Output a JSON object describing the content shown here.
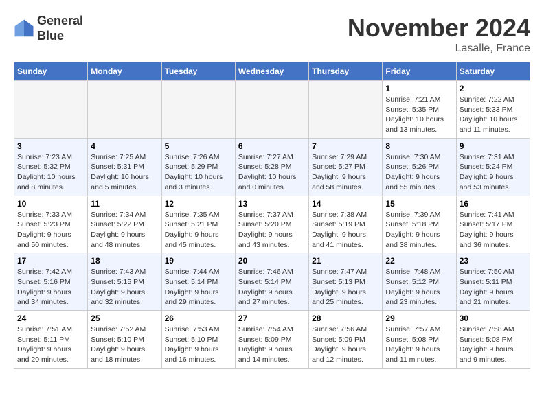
{
  "header": {
    "logo_line1": "General",
    "logo_line2": "Blue",
    "month": "November 2024",
    "location": "Lasalle, France"
  },
  "weekdays": [
    "Sunday",
    "Monday",
    "Tuesday",
    "Wednesday",
    "Thursday",
    "Friday",
    "Saturday"
  ],
  "weeks": [
    [
      {
        "day": "",
        "empty": true
      },
      {
        "day": "",
        "empty": true
      },
      {
        "day": "",
        "empty": true
      },
      {
        "day": "",
        "empty": true
      },
      {
        "day": "",
        "empty": true
      },
      {
        "day": "1",
        "sunrise": "7:21 AM",
        "sunset": "5:35 PM",
        "daylight": "10 hours and 13 minutes."
      },
      {
        "day": "2",
        "sunrise": "7:22 AM",
        "sunset": "5:33 PM",
        "daylight": "10 hours and 11 minutes."
      }
    ],
    [
      {
        "day": "3",
        "sunrise": "7:23 AM",
        "sunset": "5:32 PM",
        "daylight": "10 hours and 8 minutes."
      },
      {
        "day": "4",
        "sunrise": "7:25 AM",
        "sunset": "5:31 PM",
        "daylight": "10 hours and 5 minutes."
      },
      {
        "day": "5",
        "sunrise": "7:26 AM",
        "sunset": "5:29 PM",
        "daylight": "10 hours and 3 minutes."
      },
      {
        "day": "6",
        "sunrise": "7:27 AM",
        "sunset": "5:28 PM",
        "daylight": "10 hours and 0 minutes."
      },
      {
        "day": "7",
        "sunrise": "7:29 AM",
        "sunset": "5:27 PM",
        "daylight": "9 hours and 58 minutes."
      },
      {
        "day": "8",
        "sunrise": "7:30 AM",
        "sunset": "5:26 PM",
        "daylight": "9 hours and 55 minutes."
      },
      {
        "day": "9",
        "sunrise": "7:31 AM",
        "sunset": "5:24 PM",
        "daylight": "9 hours and 53 minutes."
      }
    ],
    [
      {
        "day": "10",
        "sunrise": "7:33 AM",
        "sunset": "5:23 PM",
        "daylight": "9 hours and 50 minutes."
      },
      {
        "day": "11",
        "sunrise": "7:34 AM",
        "sunset": "5:22 PM",
        "daylight": "9 hours and 48 minutes."
      },
      {
        "day": "12",
        "sunrise": "7:35 AM",
        "sunset": "5:21 PM",
        "daylight": "9 hours and 45 minutes."
      },
      {
        "day": "13",
        "sunrise": "7:37 AM",
        "sunset": "5:20 PM",
        "daylight": "9 hours and 43 minutes."
      },
      {
        "day": "14",
        "sunrise": "7:38 AM",
        "sunset": "5:19 PM",
        "daylight": "9 hours and 41 minutes."
      },
      {
        "day": "15",
        "sunrise": "7:39 AM",
        "sunset": "5:18 PM",
        "daylight": "9 hours and 38 minutes."
      },
      {
        "day": "16",
        "sunrise": "7:41 AM",
        "sunset": "5:17 PM",
        "daylight": "9 hours and 36 minutes."
      }
    ],
    [
      {
        "day": "17",
        "sunrise": "7:42 AM",
        "sunset": "5:16 PM",
        "daylight": "9 hours and 34 minutes."
      },
      {
        "day": "18",
        "sunrise": "7:43 AM",
        "sunset": "5:15 PM",
        "daylight": "9 hours and 32 minutes."
      },
      {
        "day": "19",
        "sunrise": "7:44 AM",
        "sunset": "5:14 PM",
        "daylight": "9 hours and 29 minutes."
      },
      {
        "day": "20",
        "sunrise": "7:46 AM",
        "sunset": "5:14 PM",
        "daylight": "9 hours and 27 minutes."
      },
      {
        "day": "21",
        "sunrise": "7:47 AM",
        "sunset": "5:13 PM",
        "daylight": "9 hours and 25 minutes."
      },
      {
        "day": "22",
        "sunrise": "7:48 AM",
        "sunset": "5:12 PM",
        "daylight": "9 hours and 23 minutes."
      },
      {
        "day": "23",
        "sunrise": "7:50 AM",
        "sunset": "5:11 PM",
        "daylight": "9 hours and 21 minutes."
      }
    ],
    [
      {
        "day": "24",
        "sunrise": "7:51 AM",
        "sunset": "5:11 PM",
        "daylight": "9 hours and 20 minutes."
      },
      {
        "day": "25",
        "sunrise": "7:52 AM",
        "sunset": "5:10 PM",
        "daylight": "9 hours and 18 minutes."
      },
      {
        "day": "26",
        "sunrise": "7:53 AM",
        "sunset": "5:10 PM",
        "daylight": "9 hours and 16 minutes."
      },
      {
        "day": "27",
        "sunrise": "7:54 AM",
        "sunset": "5:09 PM",
        "daylight": "9 hours and 14 minutes."
      },
      {
        "day": "28",
        "sunrise": "7:56 AM",
        "sunset": "5:09 PM",
        "daylight": "9 hours and 12 minutes."
      },
      {
        "day": "29",
        "sunrise": "7:57 AM",
        "sunset": "5:08 PM",
        "daylight": "9 hours and 11 minutes."
      },
      {
        "day": "30",
        "sunrise": "7:58 AM",
        "sunset": "5:08 PM",
        "daylight": "9 hours and 9 minutes."
      }
    ]
  ]
}
